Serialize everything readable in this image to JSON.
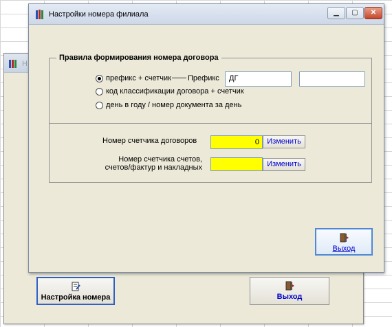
{
  "front_window": {
    "title": "Настройки номера филиала",
    "group_title": "Правила формирования номера договора",
    "radios": [
      {
        "label": "префикс + счетчик",
        "selected": true
      },
      {
        "label": "код классификации  договора + счетчик",
        "selected": false
      },
      {
        "label": "день в году / номер документа за день",
        "selected": false
      }
    ],
    "prefix_label": "Префикс",
    "prefix_value": "ДГ",
    "extra_value": "",
    "counter_label": "Номер  счетчика договоров",
    "counter_value": "0",
    "change_label": "Изменить",
    "counter2_label": "Номер  счетчика счетов,\nсчетов/фактур и накладных",
    "counter2_value": "",
    "change2_label": "Изменить",
    "exit_label": "Выход"
  },
  "back_window": {
    "title": "Н",
    "setup_button_label": "Настройка номера",
    "exit_label": "Выход"
  },
  "colors": {
    "window_bg": "#ece9d8",
    "highlight_field": "#ffff00",
    "link_text": "#0000cc"
  }
}
